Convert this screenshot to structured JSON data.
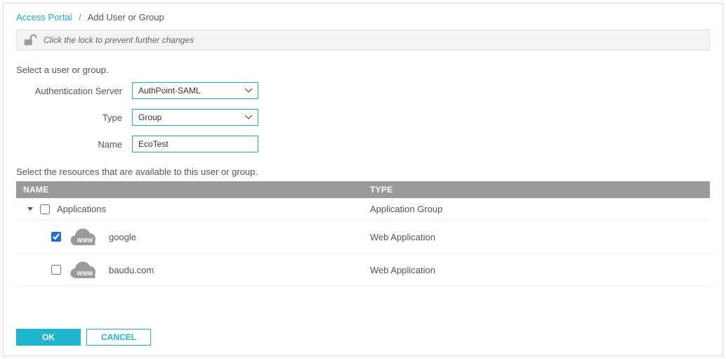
{
  "breadcrumb": {
    "root": "Access Portal",
    "current": "Add User or Group"
  },
  "lockbar": {
    "message": "Click the lock to prevent further changes"
  },
  "section1_label": "Select a user or group.",
  "form": {
    "auth_server": {
      "label": "Authentication Server",
      "value": "AuthPoint-SAML"
    },
    "type": {
      "label": "Type",
      "value": "Group"
    },
    "name": {
      "label": "Name",
      "value": "EcoTest"
    }
  },
  "section2_label": "Select the resources that are available to this user or group.",
  "table": {
    "headers": {
      "name": "NAME",
      "type": "TYPE"
    },
    "group_row": {
      "label": "Applications",
      "type": "Application Group",
      "checked": false,
      "expanded": true
    },
    "rows": [
      {
        "label": "google",
        "type": "Web Application",
        "checked": true
      },
      {
        "label": "baudu.com",
        "type": "Web Application",
        "checked": false
      }
    ]
  },
  "buttons": {
    "ok": "OK",
    "cancel": "CANCEL"
  }
}
